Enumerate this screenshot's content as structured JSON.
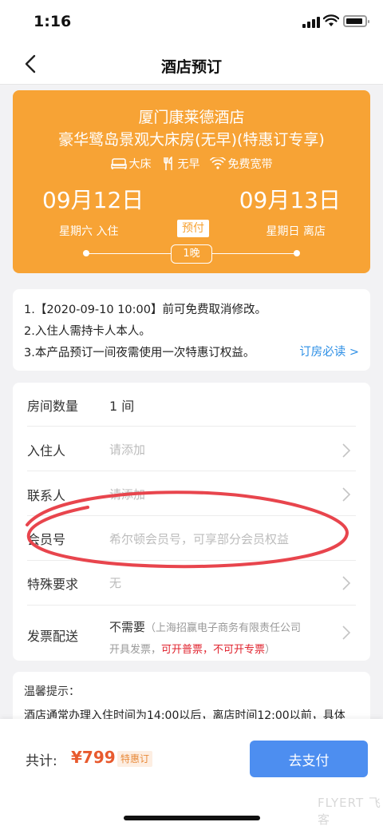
{
  "status_bar": {
    "time": "1:16"
  },
  "nav": {
    "title": "酒店预订"
  },
  "hotel": {
    "name": "厦门康莱德酒店",
    "room": "豪华鹭岛景观大床房(无早)(特惠订专享)",
    "amenities": [
      {
        "icon": "bed-icon",
        "label": "大床"
      },
      {
        "icon": "cutlery-icon",
        "label": "无早"
      },
      {
        "icon": "wifi-icon",
        "label": "免费宽带"
      }
    ],
    "checkin_date": "09月12日",
    "checkout_date": "09月13日",
    "checkin_day": "星期六 入住",
    "checkout_day": "星期日 离店",
    "payment_tag": "预付",
    "nights": "1晚",
    "card_color": "#f7a335"
  },
  "notices": {
    "lines": [
      "1.【2020-09-10 10:00】前可免费取消修改。",
      "2.入住人需持卡人本人。",
      "3.本产品预订一间夜需使用一次特惠订权益。"
    ],
    "link": "订房必读 >",
    "link_color": "#2d8fe6"
  },
  "form": {
    "rooms": {
      "label": "房间数量",
      "value": "1 间"
    },
    "guest": {
      "label": "入住人",
      "placeholder": "请添加"
    },
    "contact": {
      "label": "联系人",
      "placeholder": "请添加"
    },
    "member": {
      "label": "会员号",
      "placeholder": "希尔顿会员号，可享部分会员权益"
    },
    "special": {
      "label": "特殊要求",
      "placeholder": "无"
    },
    "invoice": {
      "label": "发票配送",
      "value": "不需要",
      "note": "（上海招赢电子商务有限责任公司",
      "sub_prefix": "开具发票，",
      "sub_red": "可开普票，不可开专票",
      "sub_suffix": "）"
    }
  },
  "tips": {
    "title": "温馨提示：",
    "text": "酒店通常办理入住时间为14:00以后，离店时间12:00以前，具体"
  },
  "footer": {
    "total_label": "共计:",
    "total_price": "¥799",
    "badge": "特惠订",
    "pay_button": "去支付",
    "pay_color": "#4d8ef0",
    "watermark": "FLYERT 飞客"
  }
}
